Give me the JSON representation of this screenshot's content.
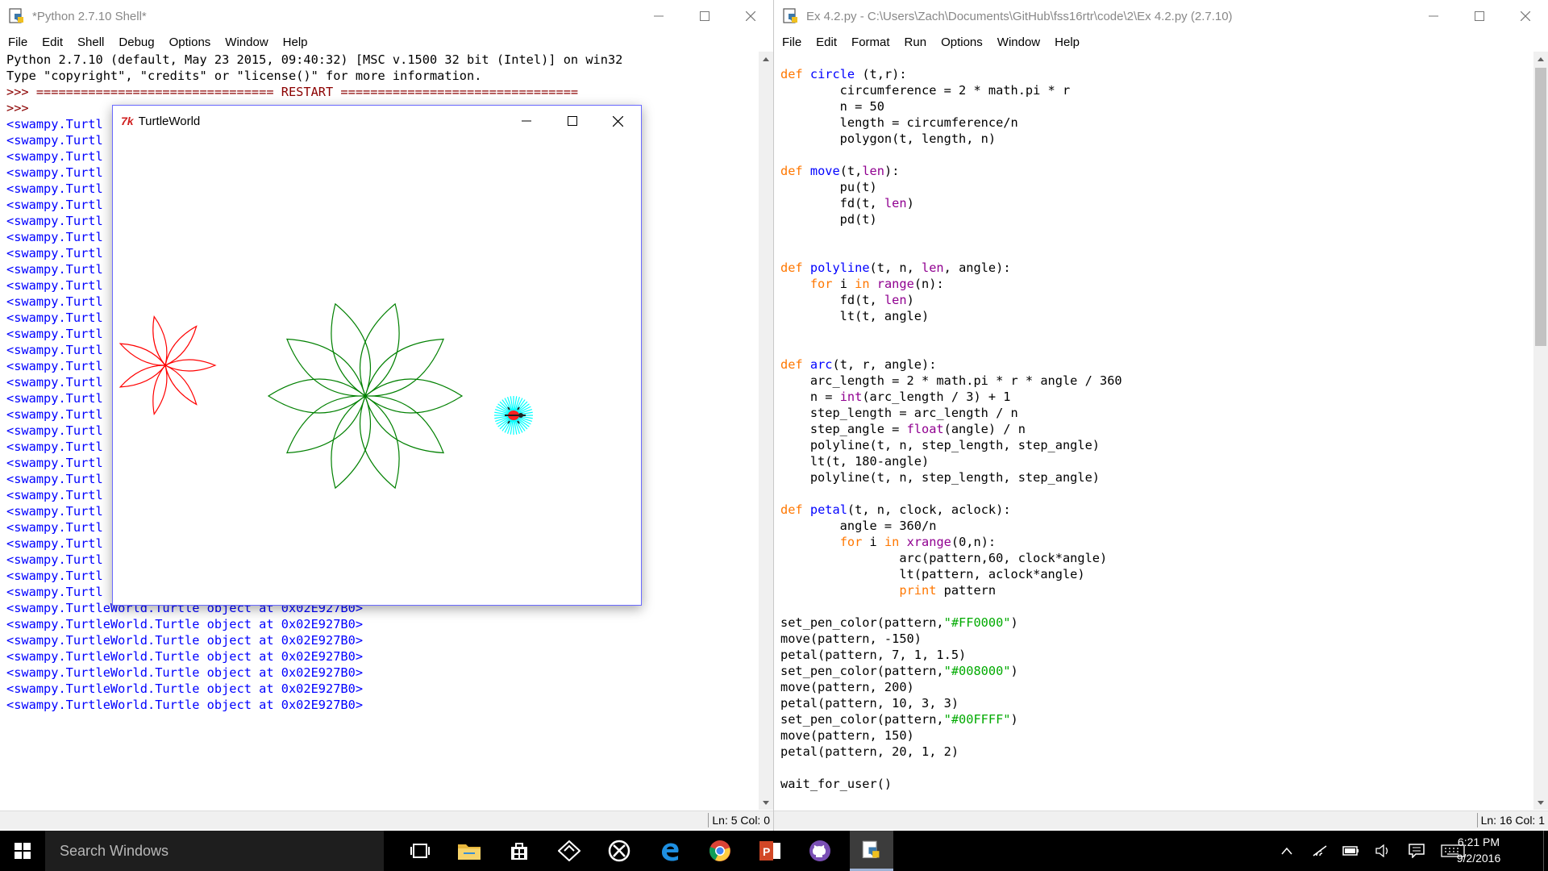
{
  "shell": {
    "title": "*Python 2.7.10 Shell*",
    "menu": [
      "File",
      "Edit",
      "Shell",
      "Debug",
      "Options",
      "Window",
      "Help"
    ],
    "header_lines": [
      "Python 2.7.10 (default, May 23 2015, 09:40:32) [MSC v.1500 32 bit (Intel)] on win32",
      "Type \"copyright\", \"credits\" or \"license()\" for more information."
    ],
    "restart_line": ">>> ================================ RESTART ================================",
    "prompt": ">>>",
    "output_truncated": [
      "<swampy.Turtl",
      "<swampy.Turtl",
      "<swampy.Turtl",
      "<swampy.Turtl",
      "<swampy.Turtl",
      "<swampy.Turtl",
      "<swampy.Turtl",
      "<swampy.Turtl",
      "<swampy.Turtl",
      "<swampy.Turtl",
      "<swampy.Turtl",
      "<swampy.Turtl",
      "<swampy.Turtl",
      "<swampy.Turtl",
      "<swampy.Turtl",
      "<swampy.Turtl",
      "<swampy.Turtl",
      "<swampy.Turtl",
      "<swampy.Turtl",
      "<swampy.Turtl",
      "<swampy.Turtl",
      "<swampy.Turtl",
      "<swampy.Turtl",
      "<swampy.Turtl",
      "<swampy.Turtl",
      "<swampy.Turtl",
      "<swampy.Turtl",
      "<swampy.Turtl",
      "<swampy.Turtl",
      "<swampy.Turtl"
    ],
    "output_full": [
      "<swampy.TurtleWorld.Turtle object at 0x02E927B0>",
      "<swampy.TurtleWorld.Turtle object at 0x02E927B0>",
      "<swampy.TurtleWorld.Turtle object at 0x02E927B0>",
      "<swampy.TurtleWorld.Turtle object at 0x02E927B0>",
      "<swampy.TurtleWorld.Turtle object at 0x02E927B0>",
      "<swampy.TurtleWorld.Turtle object at 0x02E927B0>",
      "<swampy.TurtleWorld.Turtle object at 0x02E927B0>"
    ],
    "status": "Ln: 5 Col: 0"
  },
  "turtle_world": {
    "title": "TurtleWorld",
    "icon_text": "7k",
    "petal_colors": {
      "red": "#FF0000",
      "green": "#008000",
      "cyan": "#00FFFF"
    }
  },
  "editor": {
    "title": "Ex 4.2.py - C:\\Users\\Zach\\Documents\\GitHub\\fss16rtr\\code\\2\\Ex 4.2.py (2.7.10)",
    "menu": [
      "File",
      "Edit",
      "Format",
      "Run",
      "Options",
      "Window",
      "Help"
    ],
    "code": [
      [
        [
          "kw",
          "def"
        ],
        [
          "t",
          " "
        ],
        [
          "fn",
          "circle"
        ],
        [
          "t",
          " (t,r):"
        ]
      ],
      [
        [
          "t",
          "        circumference = 2 * math.pi * r"
        ]
      ],
      [
        [
          "t",
          "        n = 50"
        ]
      ],
      [
        [
          "t",
          "        length = circumference/n"
        ]
      ],
      [
        [
          "t",
          "        polygon(t, length, n)"
        ]
      ],
      [],
      [
        [
          "kw",
          "def"
        ],
        [
          "t",
          " "
        ],
        [
          "fn",
          "move"
        ],
        [
          "t",
          "(t,"
        ],
        [
          "bi",
          "len"
        ],
        [
          "t",
          "):"
        ]
      ],
      [
        [
          "t",
          "        pu(t)"
        ]
      ],
      [
        [
          "t",
          "        fd(t, "
        ],
        [
          "bi",
          "len"
        ],
        [
          "t",
          ")"
        ]
      ],
      [
        [
          "t",
          "        pd(t)"
        ]
      ],
      [],
      [],
      [
        [
          "kw",
          "def"
        ],
        [
          "t",
          " "
        ],
        [
          "fn",
          "polyline"
        ],
        [
          "t",
          "(t, n, "
        ],
        [
          "bi",
          "len"
        ],
        [
          "t",
          ", angle):"
        ]
      ],
      [
        [
          "t",
          "    "
        ],
        [
          "kw",
          "for"
        ],
        [
          "t",
          " i "
        ],
        [
          "kw",
          "in"
        ],
        [
          "t",
          " "
        ],
        [
          "bi",
          "range"
        ],
        [
          "t",
          "(n):"
        ]
      ],
      [
        [
          "t",
          "        fd(t, "
        ],
        [
          "bi",
          "len"
        ],
        [
          "t",
          ")"
        ]
      ],
      [
        [
          "t",
          "        lt(t, angle)"
        ]
      ],
      [],
      [],
      [
        [
          "kw",
          "def"
        ],
        [
          "t",
          " "
        ],
        [
          "fn",
          "arc"
        ],
        [
          "t",
          "(t, r, angle):"
        ]
      ],
      [
        [
          "t",
          "    arc_length = 2 * math.pi * r * angle / 360"
        ]
      ],
      [
        [
          "t",
          "    n = "
        ],
        [
          "bi",
          "int"
        ],
        [
          "t",
          "(arc_length / 3) + 1"
        ]
      ],
      [
        [
          "t",
          "    step_length = arc_length / n"
        ]
      ],
      [
        [
          "t",
          "    step_angle = "
        ],
        [
          "bi",
          "float"
        ],
        [
          "t",
          "(angle) / n"
        ]
      ],
      [
        [
          "t",
          "    polyline(t, n, step_length, step_angle)"
        ]
      ],
      [
        [
          "t",
          "    lt(t, 180-angle)"
        ]
      ],
      [
        [
          "t",
          "    polyline(t, n, step_length, step_angle)"
        ]
      ],
      [],
      [
        [
          "kw",
          "def"
        ],
        [
          "t",
          " "
        ],
        [
          "fn",
          "petal"
        ],
        [
          "t",
          "(t, n, clock, aclock):"
        ]
      ],
      [
        [
          "t",
          "        angle = 360/n"
        ]
      ],
      [
        [
          "t",
          "        "
        ],
        [
          "kw",
          "for"
        ],
        [
          "t",
          " i "
        ],
        [
          "kw",
          "in"
        ],
        [
          "t",
          " "
        ],
        [
          "bi",
          "xrange"
        ],
        [
          "t",
          "(0,n):"
        ]
      ],
      [
        [
          "t",
          "                arc(pattern,60, clock*angle)"
        ]
      ],
      [
        [
          "t",
          "                lt(pattern, aclock*angle)"
        ]
      ],
      [
        [
          "t",
          "                "
        ],
        [
          "kw",
          "print"
        ],
        [
          "t",
          " pattern"
        ]
      ],
      [],
      [
        [
          "t",
          "set_pen_color(pattern,"
        ],
        [
          "str",
          "\"#FF0000\""
        ],
        [
          "t",
          ")"
        ]
      ],
      [
        [
          "t",
          "move(pattern, -150)"
        ]
      ],
      [
        [
          "t",
          "petal(pattern, 7, 1, 1.5)"
        ]
      ],
      [
        [
          "t",
          "set_pen_color(pattern,"
        ],
        [
          "str",
          "\"#008000\""
        ],
        [
          "t",
          ")"
        ]
      ],
      [
        [
          "t",
          "move(pattern, 200)"
        ]
      ],
      [
        [
          "t",
          "petal(pattern, 10, 3, 3)"
        ]
      ],
      [
        [
          "t",
          "set_pen_color(pattern,"
        ],
        [
          "str",
          "\"#00FFFF\""
        ],
        [
          "t",
          ")"
        ]
      ],
      [
        [
          "t",
          "move(pattern, 150)"
        ]
      ],
      [
        [
          "t",
          "petal(pattern, 20, 1, 2)"
        ]
      ],
      [],
      [
        [
          "t",
          "wait_for_user()"
        ]
      ]
    ],
    "status": "Ln: 16 Col: 1"
  },
  "taskbar": {
    "search_placeholder": "Search Windows",
    "time": "6:21 PM",
    "date": "9/2/2016",
    "apps": [
      "task-view",
      "file-explorer",
      "store",
      "xbox",
      "edge",
      "chrome",
      "powerpoint",
      "github",
      "python-idle"
    ]
  },
  "colors": {
    "keyword": "#ff7700",
    "definition": "#0000ff",
    "builtin": "#900090",
    "string": "#00aa00",
    "output": "#0000ff"
  }
}
